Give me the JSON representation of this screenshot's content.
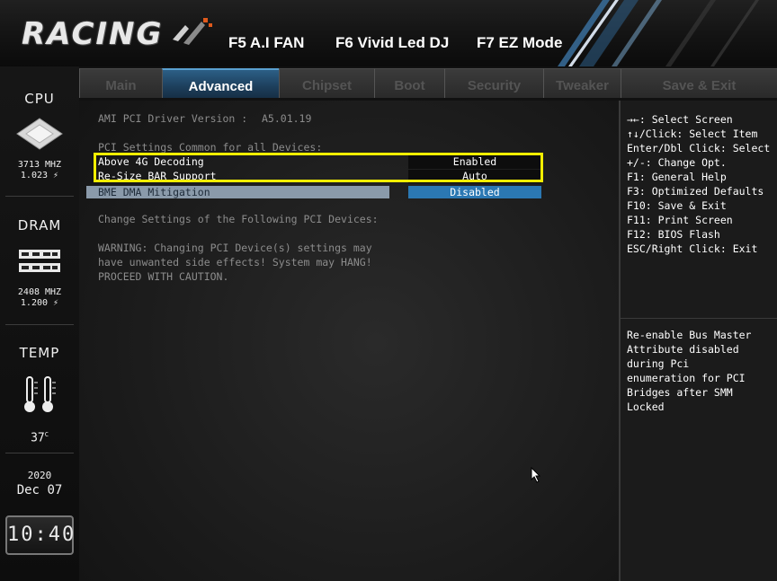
{
  "header": {
    "logo_text": "RACING",
    "function_keys": [
      "F5 A.I FAN",
      "F6 Vivid Led DJ",
      "F7 EZ Mode"
    ]
  },
  "tabs": [
    {
      "label": "Main",
      "active": false
    },
    {
      "label": "Advanced",
      "active": true
    },
    {
      "label": "Chipset",
      "active": false
    },
    {
      "label": "Boot",
      "active": false
    },
    {
      "label": "Security",
      "active": false
    },
    {
      "label": "Tweaker",
      "active": false
    },
    {
      "label": "Save & Exit",
      "active": false
    }
  ],
  "sidebar": {
    "cpu": {
      "title": "CPU",
      "freq": "3713 MHZ",
      "volt": "1.023"
    },
    "dram": {
      "title": "DRAM",
      "freq": "2408 MHZ",
      "volt": "1.200"
    },
    "temp": {
      "title": "TEMP",
      "value": "37",
      "unit": "C"
    },
    "date": {
      "year": "2020",
      "month": "Dec",
      "day": "07"
    },
    "time": "10:40"
  },
  "main": {
    "driver_label": "AMI PCI Driver Version :",
    "driver_value": "A5.01.19",
    "common_header": "PCI Settings Common for all Devices:",
    "settings": [
      {
        "label": "Above 4G Decoding",
        "value": "Enabled"
      },
      {
        "label": "Re-Size BAR Support",
        "value": "Auto"
      },
      {
        "label": "BME DMA Mitigation",
        "value": "Disabled"
      }
    ],
    "change_header": "Change Settings of the Following PCI Devices:",
    "warning": [
      "WARNING: Changing PCI Device(s) settings may",
      "have unwanted side effects! System may HANG!",
      "PROCEED WITH CAUTION."
    ]
  },
  "help": {
    "keys": [
      "→←: Select Screen",
      "↑↓/Click: Select Item",
      "Enter/Dbl Click: Select",
      "+/-: Change Opt.",
      "F1: General Help",
      "F3: Optimized Defaults",
      "F10: Save & Exit",
      "F11: Print Screen",
      "F12: BIOS Flash",
      "ESC/Right Click: Exit"
    ],
    "description": [
      "Re-enable Bus Master",
      "Attribute disabled",
      "during Pci",
      "enumeration for PCI",
      "Bridges after SMM",
      "Locked"
    ]
  },
  "colors": {
    "highlight": "#f2ee00",
    "active_tab": "#2c5f86",
    "selected_value": "#2b78b3"
  }
}
